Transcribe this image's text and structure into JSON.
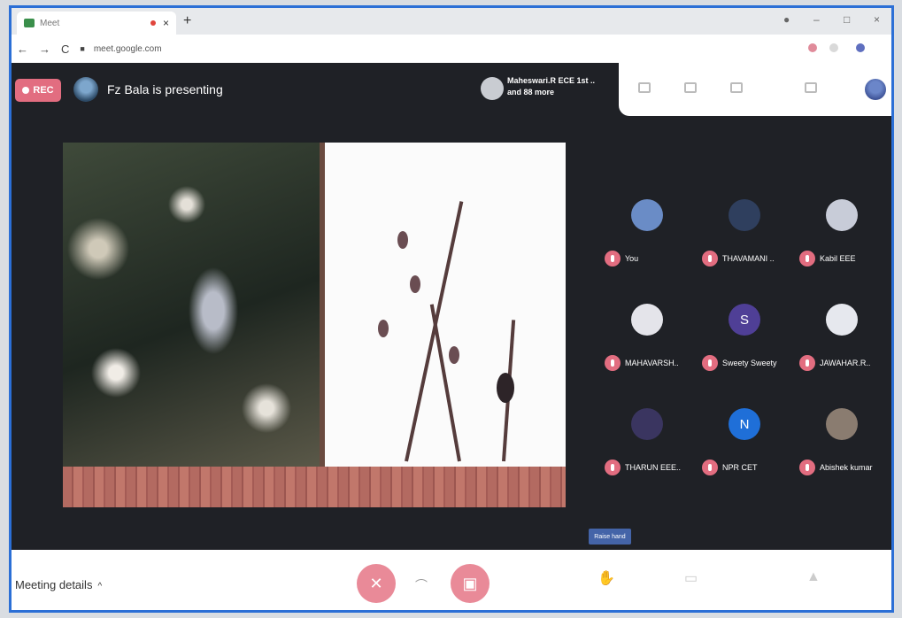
{
  "browser": {
    "tab_title": "Meet",
    "close_tab": "×",
    "new_tab": "+",
    "nav_back": "←",
    "nav_forward": "→",
    "reload": "C",
    "url": "meet.google.com"
  },
  "meeting": {
    "rec_label": "REC",
    "presenter_text": "Fz Bala is presenting",
    "participants_line1": "Maheswari.R ECE 1st ..",
    "participants_line2": "and 88 more"
  },
  "participants": [
    {
      "name": "You",
      "initial": "",
      "color": "#6a8cc6"
    },
    {
      "name": "THAVAMANI ..",
      "initial": "",
      "color": "#2f3f5e"
    },
    {
      "name": "Kabil EEE",
      "initial": "",
      "color": "#c8ccd8"
    },
    {
      "name": "MAHAVARSH..",
      "initial": "",
      "color": "#e4e4ea"
    },
    {
      "name": "Sweety Sweety",
      "initial": "S",
      "color": "#4f3f96"
    },
    {
      "name": "JAWAHAR.R..",
      "initial": "",
      "color": "#e6e8ee"
    },
    {
      "name": "THARUN EEE..",
      "initial": "",
      "color": "#3a3560"
    },
    {
      "name": "NPR CET",
      "initial": "N",
      "color": "#1f6fd8"
    },
    {
      "name": "Abishek kumar",
      "initial": "",
      "color": "#8a7c70"
    }
  ],
  "raise_hand_label": "Raise hand",
  "bottom": {
    "meeting_details": "Meeting details",
    "chevron": "^",
    "end_call": "⌒"
  },
  "colors": {
    "accent_red": "#e26d80",
    "meet_bg": "#1f2126",
    "frame_blue": "#2b6fd6"
  }
}
